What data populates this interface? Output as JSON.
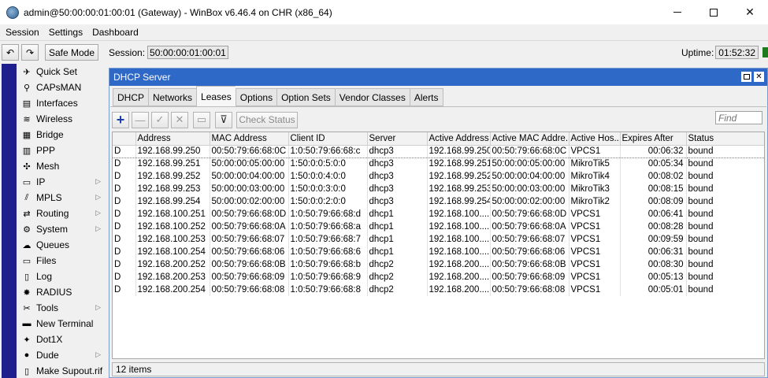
{
  "window": {
    "title": "admin@50:00:00:01:00:01 (Gateway) - WinBox v6.46.4 on CHR (x86_64)"
  },
  "menu": [
    "Session",
    "Settings",
    "Dashboard"
  ],
  "toolbar": {
    "safe_mode": "Safe Mode",
    "session_label": "Session:",
    "session_value": "50:00:00:01:00:01",
    "uptime_label": "Uptime:",
    "uptime_value": "01:52:32"
  },
  "sidebar": [
    {
      "label": "Quick Set",
      "icon": "quick-set-icon",
      "glyph": "✈",
      "arrow": false
    },
    {
      "label": "CAPsMAN",
      "icon": "capsman-icon",
      "glyph": "⚲",
      "arrow": false
    },
    {
      "label": "Interfaces",
      "icon": "interfaces-icon",
      "glyph": "▤",
      "arrow": false
    },
    {
      "label": "Wireless",
      "icon": "wireless-icon",
      "glyph": "≋",
      "arrow": false
    },
    {
      "label": "Bridge",
      "icon": "bridge-icon",
      "glyph": "▦",
      "arrow": false
    },
    {
      "label": "PPP",
      "icon": "ppp-icon",
      "glyph": "▥",
      "arrow": false
    },
    {
      "label": "Mesh",
      "icon": "mesh-icon",
      "glyph": "✣",
      "arrow": false
    },
    {
      "label": "IP",
      "icon": "ip-icon",
      "glyph": "▭",
      "arrow": true
    },
    {
      "label": "MPLS",
      "icon": "mpls-icon",
      "glyph": "⫽",
      "arrow": true
    },
    {
      "label": "Routing",
      "icon": "routing-icon",
      "glyph": "⇄",
      "arrow": true
    },
    {
      "label": "System",
      "icon": "system-icon",
      "glyph": "⚙",
      "arrow": true
    },
    {
      "label": "Queues",
      "icon": "queues-icon",
      "glyph": "☁",
      "arrow": false
    },
    {
      "label": "Files",
      "icon": "files-icon",
      "glyph": "▭",
      "arrow": false
    },
    {
      "label": "Log",
      "icon": "log-icon",
      "glyph": "▯",
      "arrow": false
    },
    {
      "label": "RADIUS",
      "icon": "radius-icon",
      "glyph": "✸",
      "arrow": false
    },
    {
      "label": "Tools",
      "icon": "tools-icon",
      "glyph": "✂",
      "arrow": true
    },
    {
      "label": "New Terminal",
      "icon": "terminal-icon",
      "glyph": "▬",
      "arrow": false
    },
    {
      "label": "Dot1X",
      "icon": "dot1x-icon",
      "glyph": "✦",
      "arrow": false
    },
    {
      "label": "Dude",
      "icon": "dude-icon",
      "glyph": "●",
      "arrow": true
    },
    {
      "label": "Make Supout.rif",
      "icon": "supout-icon",
      "glyph": "▯",
      "arrow": false
    }
  ],
  "dhcp": {
    "title": "DHCP Server",
    "tabs": [
      "DHCP",
      "Networks",
      "Leases",
      "Options",
      "Option Sets",
      "Vendor Classes",
      "Alerts"
    ],
    "active_tab": "Leases",
    "check_status": "Check Status",
    "find_placeholder": "Find",
    "columns": [
      "",
      "Address",
      "MAC Address",
      "Client ID",
      "Server",
      "Active Address",
      "Active MAC Addre...",
      "Active Hos...",
      "Expires After",
      "Status"
    ],
    "rows": [
      [
        "D",
        "192.168.99.250",
        "00:50:79:66:68:0C",
        "1:0:50:79:66:68:c",
        "dhcp3",
        "192.168.99.250",
        "00:50:79:66:68:0C",
        "VPCS1",
        "00:06:32",
        "bound"
      ],
      [
        "D",
        "192.168.99.251",
        "50:00:00:05:00:00",
        "1:50:0:0:5:0:0",
        "dhcp3",
        "192.168.99.251",
        "50:00:00:05:00:00",
        "MikroTik5",
        "00:05:34",
        "bound"
      ],
      [
        "D",
        "192.168.99.252",
        "50:00:00:04:00:00",
        "1:50:0:0:4:0:0",
        "dhcp3",
        "192.168.99.252",
        "50:00:00:04:00:00",
        "MikroTik4",
        "00:08:02",
        "bound"
      ],
      [
        "D",
        "192.168.99.253",
        "50:00:00:03:00:00",
        "1:50:0:0:3:0:0",
        "dhcp3",
        "192.168.99.253",
        "50:00:00:03:00:00",
        "MikroTik3",
        "00:08:15",
        "bound"
      ],
      [
        "D",
        "192.168.99.254",
        "50:00:00:02:00:00",
        "1:50:0:0:2:0:0",
        "dhcp3",
        "192.168.99.254",
        "50:00:00:02:00:00",
        "MikroTik2",
        "00:08:09",
        "bound"
      ],
      [
        "D",
        "192.168.100.251",
        "00:50:79:66:68:0D",
        "1:0:50:79:66:68:d",
        "dhcp1",
        "192.168.100....",
        "00:50:79:66:68:0D",
        "VPCS1",
        "00:06:41",
        "bound"
      ],
      [
        "D",
        "192.168.100.252",
        "00:50:79:66:68:0A",
        "1:0:50:79:66:68:a",
        "dhcp1",
        "192.168.100....",
        "00:50:79:66:68:0A",
        "VPCS1",
        "00:08:28",
        "bound"
      ],
      [
        "D",
        "192.168.100.253",
        "00:50:79:66:68:07",
        "1:0:50:79:66:68:7",
        "dhcp1",
        "192.168.100....",
        "00:50:79:66:68:07",
        "VPCS1",
        "00:09:59",
        "bound"
      ],
      [
        "D",
        "192.168.100.254",
        "00:50:79:66:68:06",
        "1:0:50:79:66:68:6",
        "dhcp1",
        "192.168.100....",
        "00:50:79:66:68:06",
        "VPCS1",
        "00:06:31",
        "bound"
      ],
      [
        "D",
        "192.168.200.252",
        "00:50:79:66:68:0B",
        "1:0:50:79:66:68:b",
        "dhcp2",
        "192.168.200....",
        "00:50:79:66:68:0B",
        "VPCS1",
        "00:08:30",
        "bound"
      ],
      [
        "D",
        "192.168.200.253",
        "00:50:79:66:68:09",
        "1:0:50:79:66:68:9",
        "dhcp2",
        "192.168.200....",
        "00:50:79:66:68:09",
        "VPCS1",
        "00:05:13",
        "bound"
      ],
      [
        "D",
        "192.168.200.254",
        "00:50:79:66:68:08",
        "1:0:50:79:66:68:8",
        "dhcp2",
        "192.168.200....",
        "00:50:79:66:68:08",
        "VPCS1",
        "00:05:01",
        "bound"
      ]
    ],
    "item_count": "12 items"
  }
}
